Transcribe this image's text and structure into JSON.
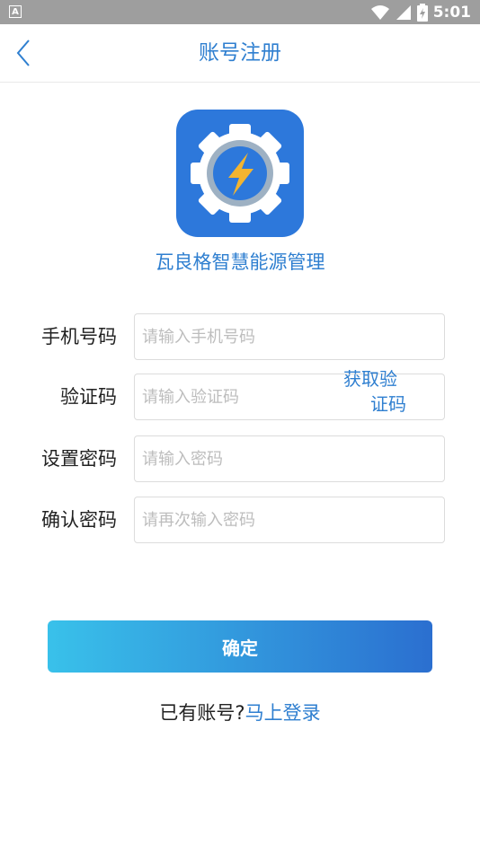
{
  "status_bar": {
    "indicator": "A",
    "time": "5:01",
    "icons": [
      "wifi-icon",
      "signal-icon",
      "battery-icon"
    ]
  },
  "header": {
    "title": "账号注册",
    "back_icon": "chevron-left-icon"
  },
  "logo": {
    "icon": "gear-lightning-icon",
    "app_name": "瓦良格智慧能源管理"
  },
  "form": {
    "phone": {
      "label": "手机号码",
      "placeholder": "请输入手机号码",
      "value": ""
    },
    "code": {
      "label": "验证码",
      "placeholder": "请输入验证码",
      "value": "",
      "get_code_line1": "获取验",
      "get_code_line2": "证码"
    },
    "password": {
      "label": "设置密码",
      "placeholder": "请输入密码",
      "value": ""
    },
    "confirm_password": {
      "label": "确认密码",
      "placeholder": "请再次输入密码",
      "value": ""
    }
  },
  "confirm_label": "确定",
  "login": {
    "prompt": "已有账号?",
    "link": "马上登录"
  },
  "colors": {
    "accent": "#2f7fd0",
    "gradient_start": "#39c1ea",
    "gradient_end": "#2b6fd0",
    "logo_bg": "#2d78db",
    "bolt": "#f2b430"
  }
}
